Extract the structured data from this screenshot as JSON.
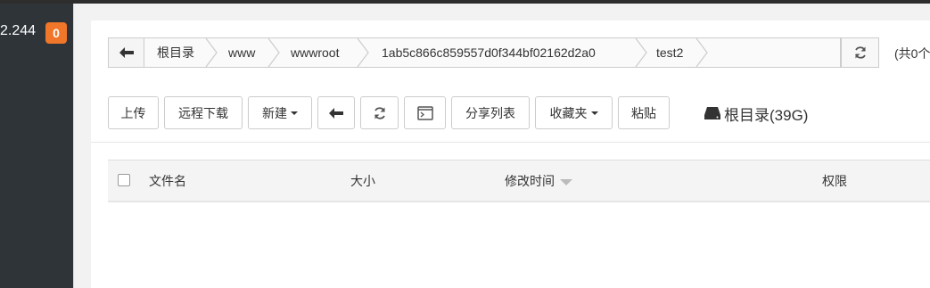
{
  "sidebar": {
    "ip": "2.244",
    "badge": "0"
  },
  "path": {
    "crumbs": [
      "根目录",
      "www",
      "wwwroot",
      "1ab5c866c859557d0f344bf02162d2a0",
      "test2"
    ],
    "count_text": "(共0个"
  },
  "toolbar": {
    "upload": "上传",
    "remote_download": "远程下载",
    "new": "新建",
    "share_list": "分享列表",
    "favorites": "收藏夹",
    "paste": "粘贴",
    "disk": "根目录(39G)"
  },
  "table": {
    "columns": [
      "文件名",
      "大小",
      "修改时间",
      "权限"
    ]
  },
  "colors": {
    "badge": "#f0762a",
    "sidebar": "#2f3439"
  }
}
